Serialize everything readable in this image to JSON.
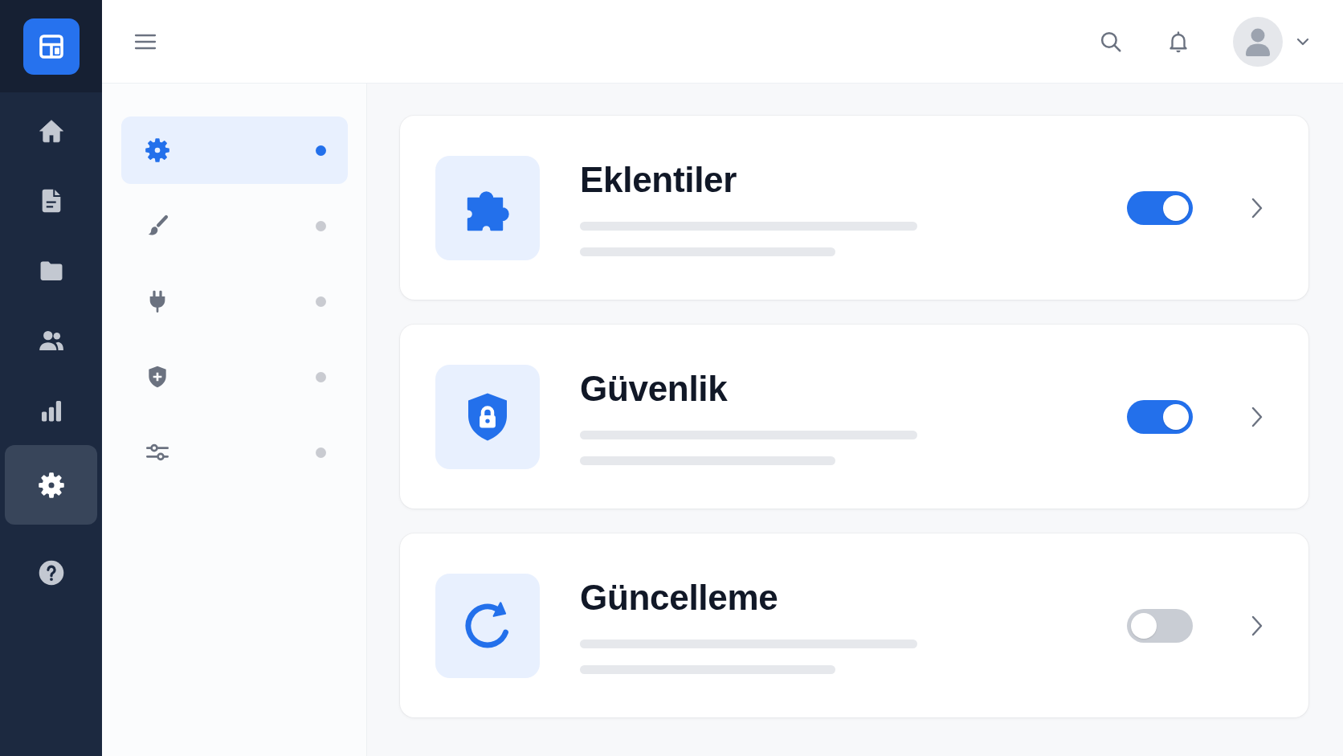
{
  "rail": {
    "items": [
      {
        "kind": "home",
        "selected": false
      },
      {
        "kind": "document",
        "selected": false
      },
      {
        "kind": "folder",
        "selected": false
      },
      {
        "kind": "users",
        "selected": false
      },
      {
        "kind": "chart",
        "selected": false
      },
      {
        "kind": "settings",
        "selected": true
      },
      {
        "kind": "help",
        "selected": false
      }
    ]
  },
  "settings_nav": {
    "items": [
      {
        "kind": "gear",
        "selected": true
      },
      {
        "kind": "brush",
        "selected": false
      },
      {
        "kind": "plug",
        "selected": false
      },
      {
        "kind": "shield",
        "selected": false
      },
      {
        "kind": "sliders",
        "selected": false
      }
    ]
  },
  "cards": [
    {
      "kind": "puzzle",
      "title": "Eklentiler",
      "on": true
    },
    {
      "kind": "lock",
      "title": "Güvenlik",
      "on": true
    },
    {
      "kind": "refresh",
      "title": "Güncelleme",
      "on": false
    }
  ]
}
